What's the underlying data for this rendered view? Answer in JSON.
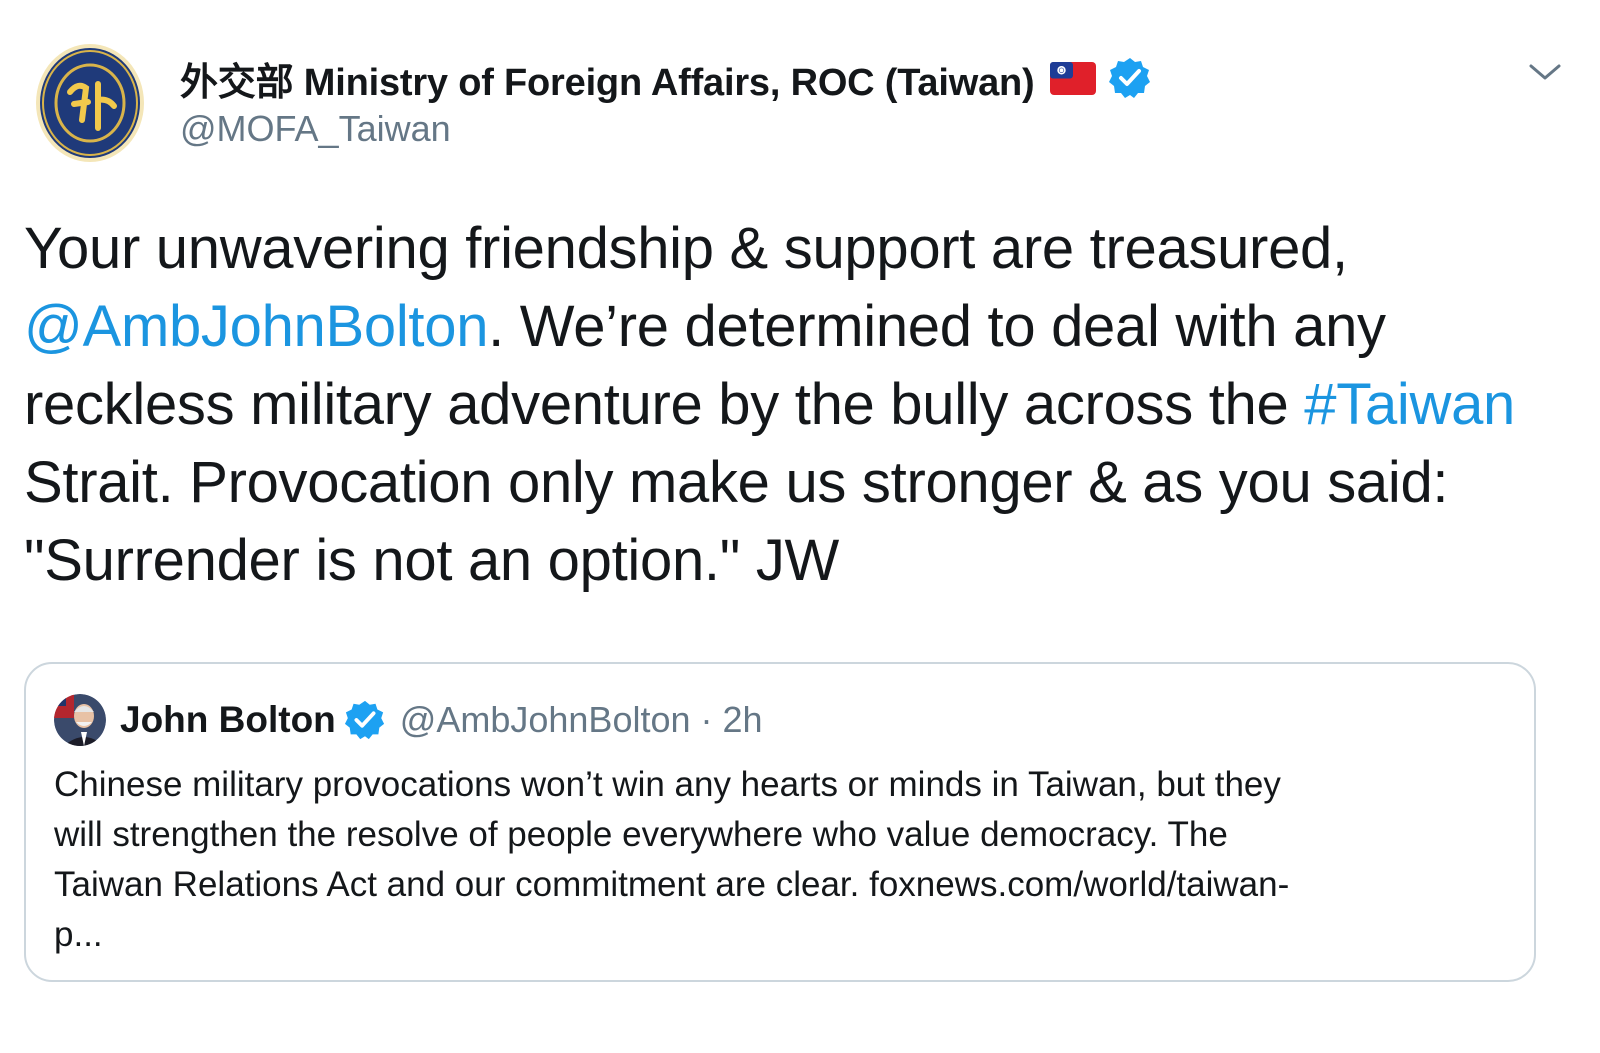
{
  "tweet": {
    "author": {
      "display_name": "外交部 Ministry of Foreign Affairs, ROC (Taiwan)",
      "handle": "@MOFA_Taiwan",
      "avatar_icon": "mofa-seal-icon",
      "flag_icon": "taiwan-flag-icon",
      "verified_icon": "verified-badge-icon"
    },
    "menu_icon": "chevron-down-icon",
    "text_lines": [
      [
        {
          "text": "Your unwavering friendship & support are treasured,",
          "link": false
        }
      ],
      [
        {
          "text": "@AmbJohnBolton",
          "link": true
        },
        {
          "text": ". We’re determined to deal with any",
          "link": false
        }
      ],
      [
        {
          "text": "reckless military adventure by the bully across the ",
          "link": false
        },
        {
          "text": "#Taiwan",
          "link": true
        }
      ],
      [
        {
          "text": "Strait. Provocation only make us stronger & as you said:",
          "link": false
        }
      ],
      [
        {
          "text": "\"Surrender is not an option.\" JW",
          "link": false
        }
      ]
    ],
    "quoted": {
      "display_name": "John Bolton",
      "handle": "@AmbJohnBolton",
      "separator": "·",
      "time": "2h",
      "text_lines": [
        "Chinese military provocations won’t win any hearts or minds in Taiwan, but they",
        "will strengthen the resolve of people everywhere who value democracy. The",
        "Taiwan Relations Act and our commitment are clear. foxnews.com/world/taiwan-",
        "p..."
      ]
    }
  },
  "colors": {
    "link": "#1b95e0",
    "text": "#14171a",
    "secondary": "#657786",
    "border": "#ccd6dd",
    "verified": "#1da1f2"
  }
}
